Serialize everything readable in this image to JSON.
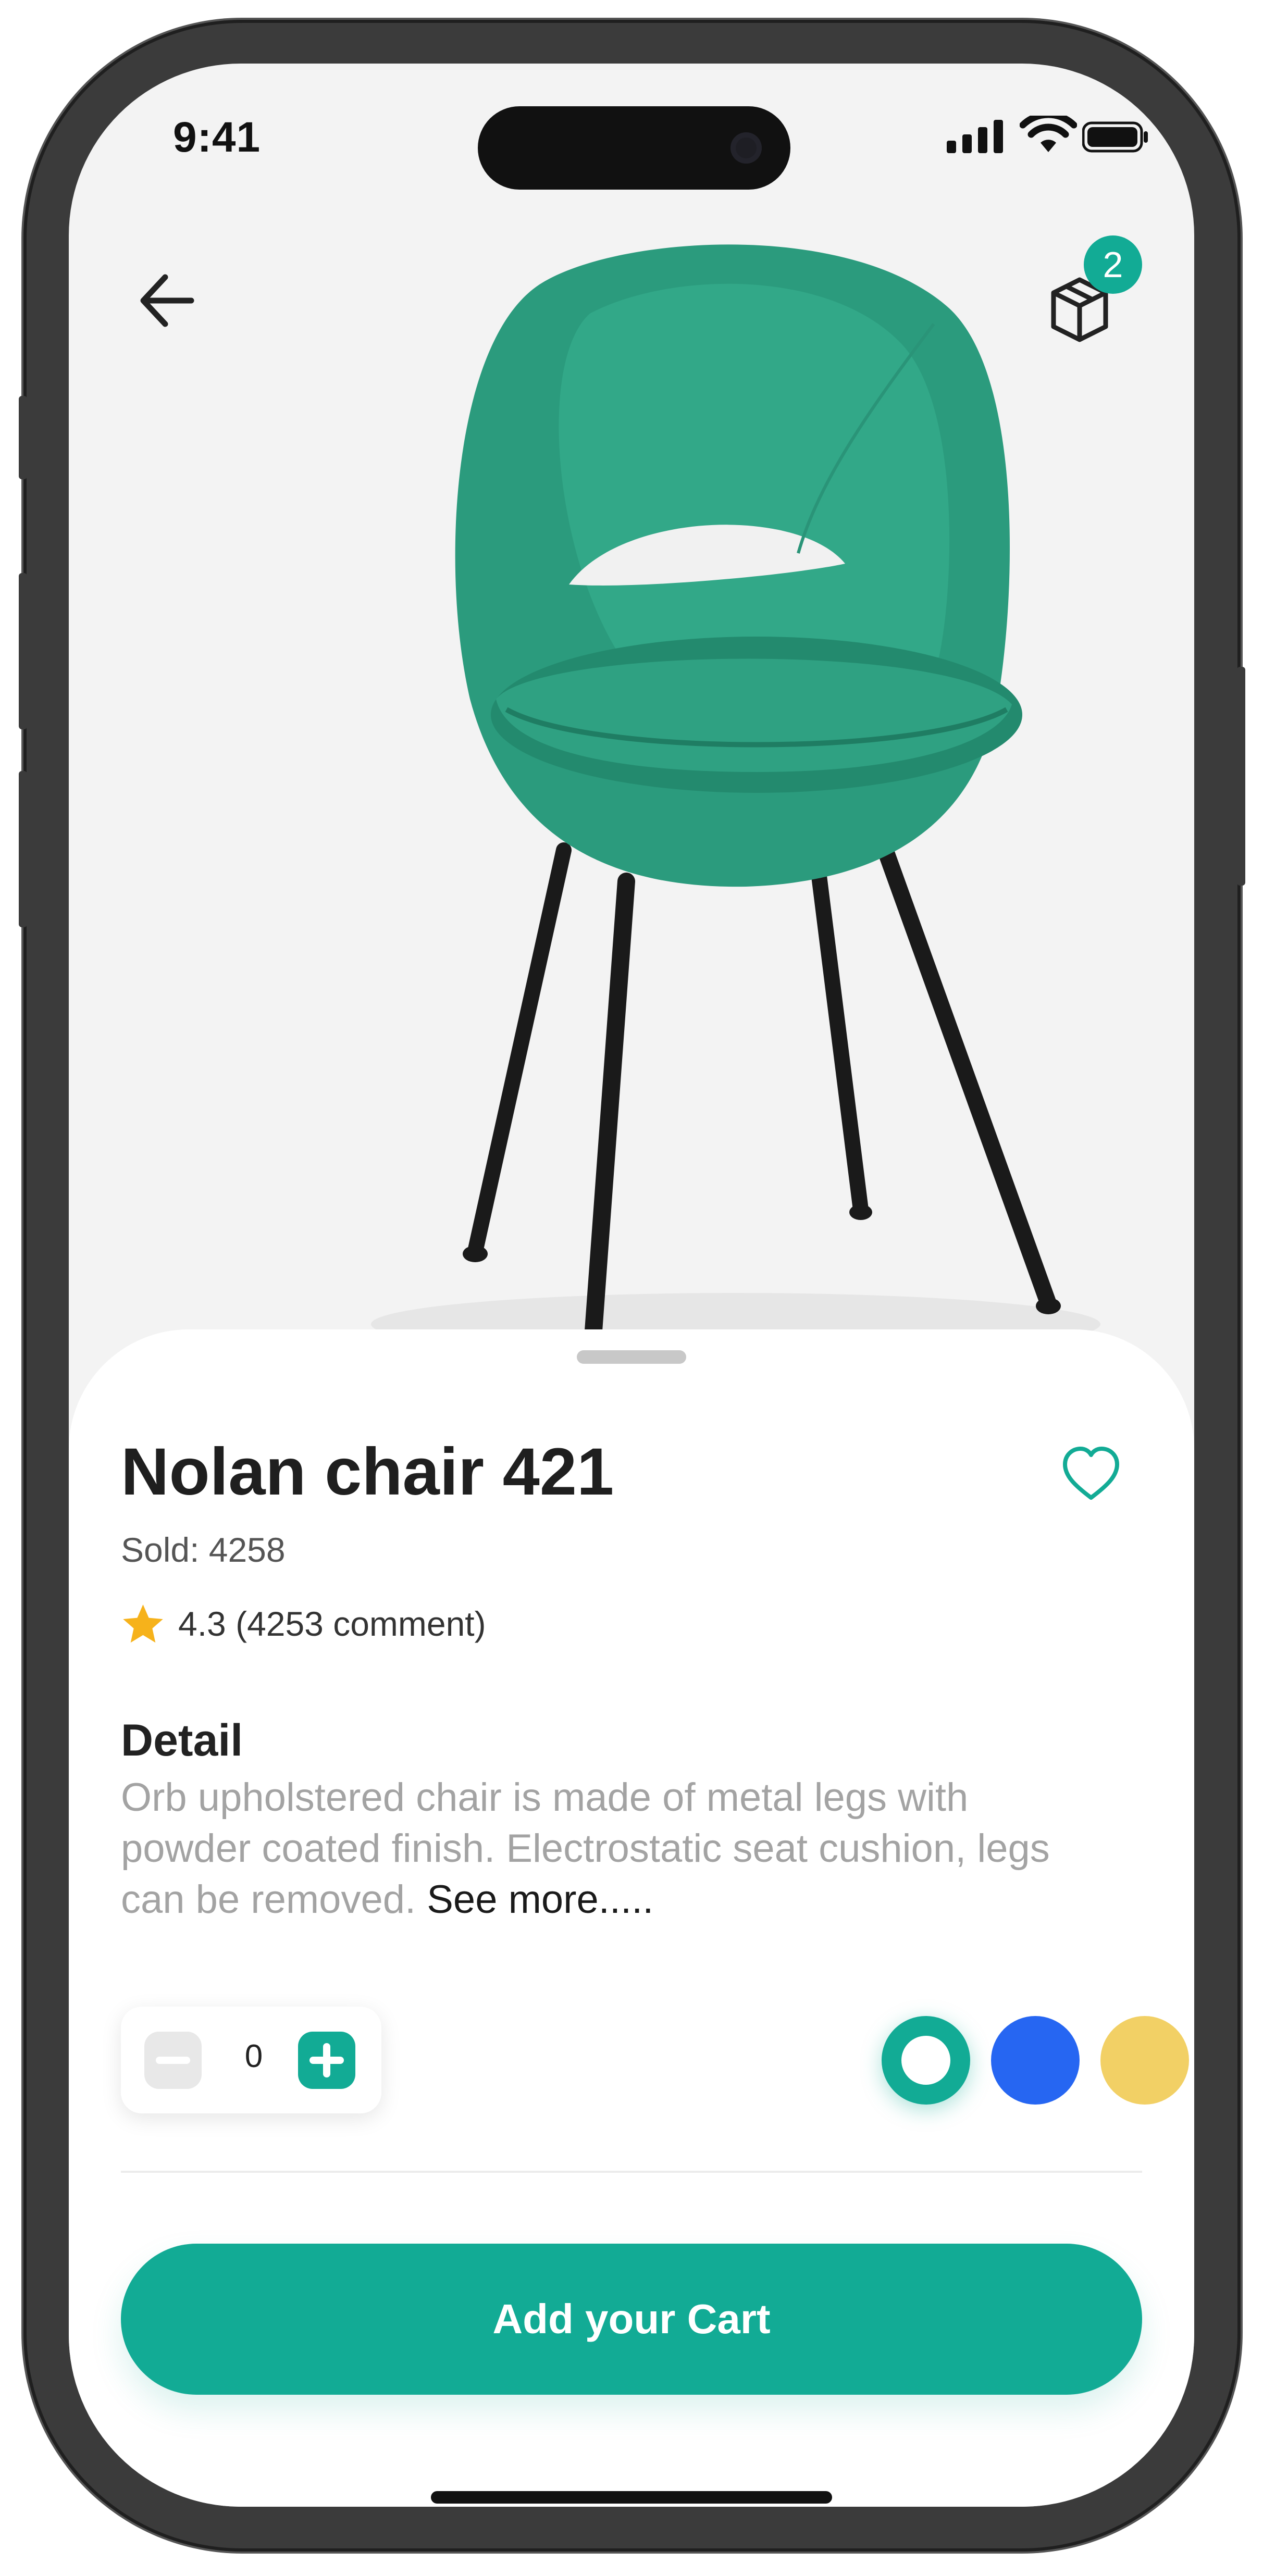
{
  "status_bar": {
    "time": "9:41",
    "icons": [
      "signal-icon",
      "wifi-icon",
      "battery-icon"
    ]
  },
  "header": {
    "back_icon": "arrow-left-icon",
    "cart_icon": "box-icon",
    "cart_count": "2"
  },
  "product": {
    "image": "green-upholstered-chair",
    "name": "Nolan chair 421",
    "sold": "Sold: 4258",
    "rating": "4.3 (4253 comment)",
    "detail_title": "Detail",
    "detail_text": "Orb upholstered chair is made of metal legs with powder coated finish. Electrostatic seat cushion, legs can be removed.",
    "see_more": "See more....."
  },
  "quantity": {
    "value": "0"
  },
  "colors": {
    "accent": "#12AB95",
    "options": [
      {
        "name": "teal",
        "hex": "#12AB95",
        "selected": true
      },
      {
        "name": "blue",
        "hex": "#2666F2",
        "selected": false
      },
      {
        "name": "yellow",
        "hex": "#F2D065",
        "selected": false
      }
    ]
  },
  "cta": {
    "label": "Add your Cart"
  }
}
